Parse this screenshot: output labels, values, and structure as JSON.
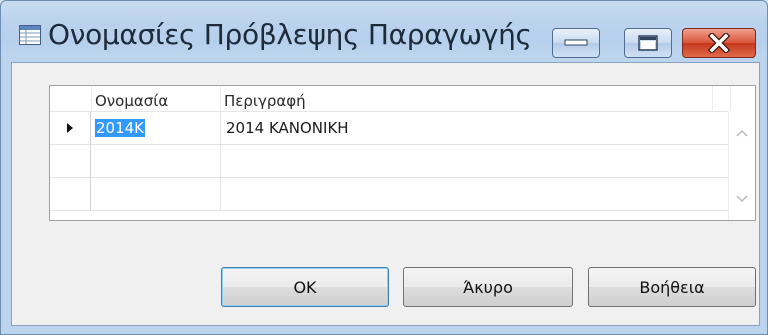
{
  "window": {
    "title": "Ονομασίες Πρόβλεψης Παραγωγής",
    "icons": {
      "app": "grid-window-icon",
      "minimize": "minimize-icon",
      "maximize": "maximize-icon",
      "close": "close-icon"
    }
  },
  "grid": {
    "columns": [
      "Ονομασία",
      "Περιγραφή"
    ],
    "rows": [
      {
        "code": "2014K",
        "description": "2014 KANONIKH",
        "current": true,
        "selected_cell": "code"
      },
      {
        "code": "",
        "description": ""
      },
      {
        "code": "",
        "description": ""
      }
    ],
    "icons": {
      "row_marker": "row-pointer-icon",
      "scroll_up": "scroll-up-icon",
      "scroll_down": "scroll-down-icon"
    }
  },
  "buttons": {
    "ok": "OK",
    "cancel": "Άκυρο",
    "help": "Βοήθεια"
  },
  "colors": {
    "selection": "#3399ff",
    "close_button": "#c7381d",
    "frame": "#bcd3ee"
  }
}
